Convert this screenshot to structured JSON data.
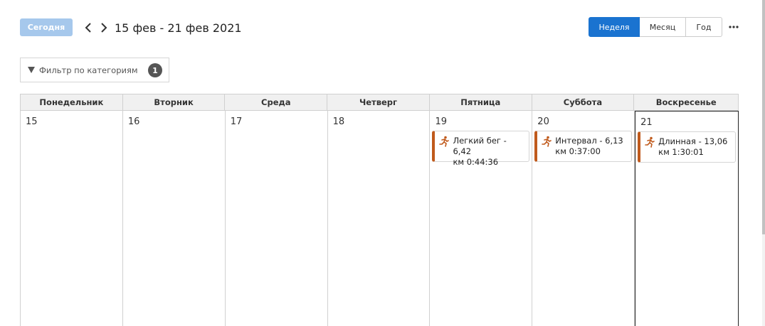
{
  "toolbar": {
    "today_label": "Сегодня",
    "date_range": "15 фев - 21 фев 2021",
    "prev_icon": "chevron-left-icon",
    "next_icon": "chevron-right-icon",
    "views": {
      "week": "Неделя",
      "month": "Месяц",
      "year": "Год"
    },
    "active_view": "week",
    "more_icon": "ellipsis-icon"
  },
  "filter": {
    "label": "Фильтр по категориям",
    "count": "1",
    "icon": "filter-funnel-icon"
  },
  "calendar": {
    "days": [
      {
        "name": "Понедельник",
        "date": "15"
      },
      {
        "name": "Вторник",
        "date": "16"
      },
      {
        "name": "Среда",
        "date": "17"
      },
      {
        "name": "Четверг",
        "date": "18"
      },
      {
        "name": "Пятница",
        "date": "19"
      },
      {
        "name": "Суббота",
        "date": "20"
      },
      {
        "name": "Воскресенье",
        "date": "21"
      }
    ],
    "events": {
      "fri": {
        "line1": "Легкий бег - 6,42",
        "line2": "км 0:44:36"
      },
      "sat": {
        "line1": "Интервал - 6,13",
        "line2": "км 0:37:00"
      },
      "sun": {
        "line1": "Длинная - 13,06",
        "line2": "км 1:30:01"
      }
    }
  },
  "colors": {
    "accent": "#1a73d0",
    "today_button": "#a6c8ec",
    "event_bar": "#c05a1c",
    "badge": "#555555"
  }
}
